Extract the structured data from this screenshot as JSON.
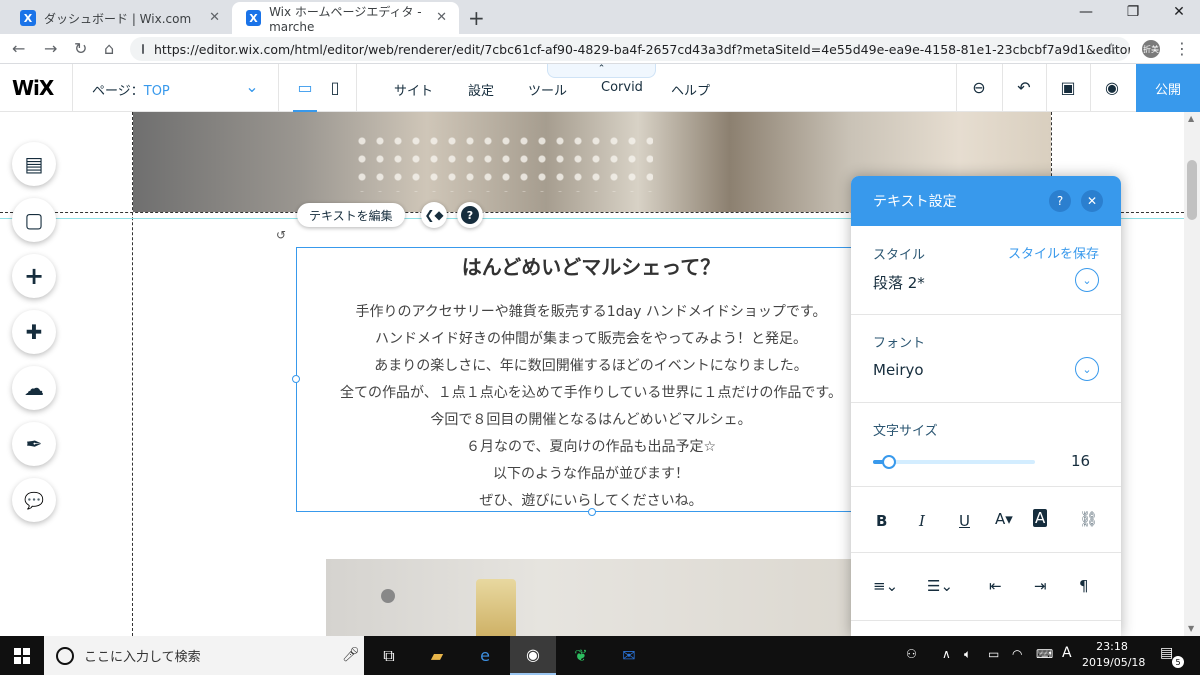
{
  "browser": {
    "tabs": [
      {
        "label": "ダッシュボード | Wix.com",
        "active": false
      },
      {
        "label": "Wix ホームページエディタ - marche",
        "active": true
      }
    ],
    "url": "https://editor.wix.com/html/editor/web/renderer/edit/7cbc61cf-af90-4829-ba4f-2657cd43a3df?metaSiteId=4e55d49e-ea9e-4158-81e1-23cbcbf7a9d1&editor...",
    "avatar_label": "折美"
  },
  "wix_topbar": {
    "logo": "WiX",
    "page_label": "ページ：",
    "page_value": "TOP",
    "menus": [
      "サイト",
      "設定",
      "ツール",
      "Corvid",
      "ヘルプ"
    ],
    "publish_label": "公開"
  },
  "canvas": {
    "edit_text_button": "テキストを編集",
    "heading": "はんどめいどマルシェって？",
    "paragraph_lines": [
      "手作りのアクセサリーや雑貨を販売する1day ハンドメイドショップです。",
      "ハンドメイド好きの仲間が集まって販売会をやってみよう！と発足。",
      "あまりの楽しさに、年に数回開催するほどのイベントになりました。",
      "全ての作品が、１点１点心を込めて手作りしている世界に１点だけの作品です。",
      "今回で８回目の開催となるはんどめいどマルシェ。",
      "６月なので、夏向けの作品も出品予定☆",
      "以下のような作品が並びます！",
      "ぜひ、遊びにいらしてくださいね。"
    ]
  },
  "left_rail": [
    {
      "name": "pages-menu-icon",
      "glyph": "▤"
    },
    {
      "name": "background-icon",
      "glyph": "▢"
    },
    {
      "name": "add-icon",
      "glyph": "+"
    },
    {
      "name": "add-apps-icon",
      "glyph": "✚"
    },
    {
      "name": "media-upload-icon",
      "glyph": "☁"
    },
    {
      "name": "blog-pen-icon",
      "glyph": "✒"
    },
    {
      "name": "chat-icon",
      "glyph": "💬"
    }
  ],
  "text_panel": {
    "title": "テキスト設定",
    "style_label": "スタイル",
    "save_style_link": "スタイルを保存",
    "style_value": "段落 2*",
    "font_label": "フォント",
    "font_value": "Meiryo",
    "size_label": "文字サイズ",
    "size_value": "16",
    "size_fraction": 0.1,
    "format_buttons": [
      "B",
      "I",
      "U"
    ]
  },
  "taskbar": {
    "search_placeholder": "ここに入力して検索",
    "time": "23:18",
    "date": "2019/05/18",
    "ime": "A",
    "notifications": "5"
  },
  "colors": {
    "accent": "#3899ec",
    "wix_text": "#162d3d"
  }
}
